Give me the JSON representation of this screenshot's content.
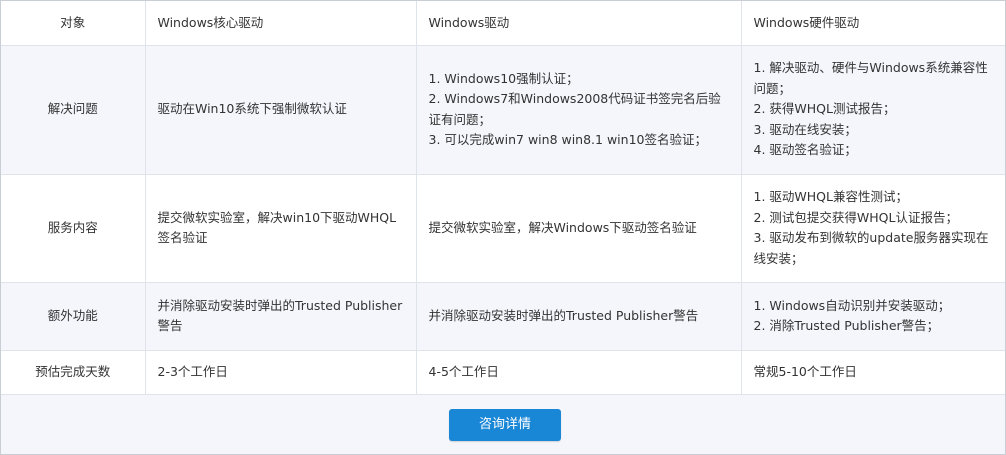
{
  "table": {
    "headers": [
      "对象",
      "Windows核心驱动",
      "Windows驱动",
      "Windows硬件驱动"
    ],
    "rows": [
      {
        "label": "解决问题",
        "cells": [
          [
            "驱动在Win10系统下强制微软认证"
          ],
          [
            "1. Windows10强制认证；",
            "2. Windows7和Windows2008代码证书签完名后验证有问题；",
            "3. 可以完成win7 win8 win8.1 win10签名验证；"
          ],
          [
            "1. 解决驱动、硬件与Windows系统兼容性问题；",
            "2. 获得WHQL测试报告；",
            "3. 驱动在线安装；",
            "4. 驱动签名验证；"
          ]
        ]
      },
      {
        "label": "服务内容",
        "cells": [
          [
            "提交微软实验室，解决win10下驱动WHQL签名验证"
          ],
          [
            "提交微软实验室，解决Windows下驱动签名验证"
          ],
          [
            "1. 驱动WHQL兼容性测试；",
            "2. 测试包提交获得WHQL认证报告；",
            "3. 驱动发布到微软的update服务器实现在线安装；"
          ]
        ]
      },
      {
        "label": "额外功能",
        "cells": [
          [
            "并消除驱动安装时弹出的Trusted Publisher警告"
          ],
          [
            "并消除驱动安装时弹出的Trusted Publisher警告"
          ],
          [
            "1. Windows自动识别并安装驱动；",
            "2. 消除Trusted Publisher警告；"
          ]
        ]
      },
      {
        "label": "预估完成天数",
        "cells": [
          [
            "2-3个工作日"
          ],
          [
            "4-5个工作日"
          ],
          [
            "常规5-10个工作日"
          ]
        ]
      }
    ]
  },
  "button": {
    "label": "咨询详情"
  },
  "colors": {
    "button": "#1a86d6",
    "alt_row": "#f4f6fb",
    "border": "#dfe3ea",
    "text": "#333333"
  }
}
